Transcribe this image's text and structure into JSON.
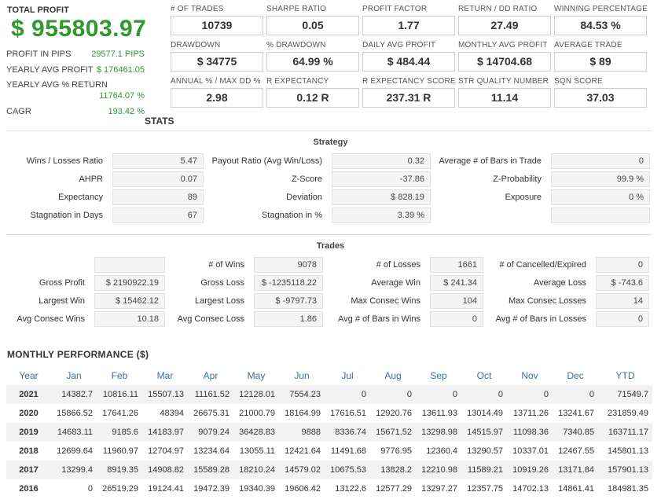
{
  "summary": {
    "total_profit_label": "TOTAL PROFIT",
    "total_profit_value": "$ 955803.97",
    "rows": [
      {
        "label": "PROFIT IN PIPS",
        "value": "29577.1 PIPS"
      },
      {
        "label": "YEARLY AVG PROFIT",
        "value": "$ 176461.05"
      },
      {
        "label": "YEARLY AVG % RETURN",
        "value": "11764.07 %"
      },
      {
        "label": "CAGR",
        "value": "193.42 %"
      }
    ]
  },
  "kpis": [
    {
      "label": "# OF TRADES",
      "value": "10739"
    },
    {
      "label": "SHARPE RATIO",
      "value": "0.05"
    },
    {
      "label": "PROFIT FACTOR",
      "value": "1.77"
    },
    {
      "label": "RETURN / DD RATIO",
      "value": "27.49"
    },
    {
      "label": "WINNING PERCENTAGE",
      "value": "84.53 %"
    },
    {
      "label": "DRAWDOWN",
      "value": "$ 34775"
    },
    {
      "label": "% DRAWDOWN",
      "value": "64.99 %"
    },
    {
      "label": "DAILY AVG PROFIT",
      "value": "$ 484.44"
    },
    {
      "label": "MONTHLY AVG PROFIT",
      "value": "$ 14704.68"
    },
    {
      "label": "AVERAGE TRADE",
      "value": "$ 89"
    },
    {
      "label": "ANNUAL % / MAX DD %",
      "value": "2.98"
    },
    {
      "label": "R EXPECTANCY",
      "value": "0.12 R"
    },
    {
      "label": "R EXPECTANCY SCORE",
      "value": "237.31 R"
    },
    {
      "label": "STR QUALITY NUMBER",
      "value": "11.14"
    },
    {
      "label": "SQN SCORE",
      "value": "37.03"
    }
  ],
  "stats_title": "STATS",
  "strategy": {
    "title": "Strategy",
    "rows": [
      [
        {
          "label": "Wins / Losses Ratio",
          "value": "5.47"
        },
        {
          "label": "Payout Ratio (Avg Win/Loss)",
          "value": "0.32"
        },
        {
          "label": "Average # of Bars in Trade",
          "value": "0"
        }
      ],
      [
        {
          "label": "AHPR",
          "value": "0.07"
        },
        {
          "label": "Z-Score",
          "value": "-37.86"
        },
        {
          "label": "Z-Probability",
          "value": "99.9 %"
        }
      ],
      [
        {
          "label": "Expectancy",
          "value": "89"
        },
        {
          "label": "Deviation",
          "value": "$ 828.19"
        },
        {
          "label": "Exposure",
          "value": "0 %"
        }
      ],
      [
        {
          "label": "Stagnation in Days",
          "value": "67"
        },
        {
          "label": "Stagnation in %",
          "value": "3.39 %"
        },
        {
          "label": "",
          "value": ""
        }
      ]
    ]
  },
  "trades": {
    "title": "Trades",
    "rows": [
      [
        {
          "label": "",
          "value": ""
        },
        {
          "label": "# of Wins",
          "value": "9078"
        },
        {
          "label": "# of Losses",
          "value": "1661"
        },
        {
          "label": "# of Cancelled/Expired",
          "value": "0"
        }
      ],
      [
        {
          "label": "Gross Profit",
          "value": "$ 2190922.19"
        },
        {
          "label": "Gross Loss",
          "value": "$ -1235118.22"
        },
        {
          "label": "Average Win",
          "value": "$ 241.34"
        },
        {
          "label": "Average Loss",
          "value": "$ -743.6"
        }
      ],
      [
        {
          "label": "Largest Win",
          "value": "$ 15462.12"
        },
        {
          "label": "Largest Loss",
          "value": "$ -9797.73"
        },
        {
          "label": "Max Consec Wins",
          "value": "104"
        },
        {
          "label": "Max Consec Losses",
          "value": "14"
        }
      ],
      [
        {
          "label": "Avg Consec Wins",
          "value": "10.18"
        },
        {
          "label": "Avg Consec Loss",
          "value": "1.86"
        },
        {
          "label": "Avg # of Bars in Wins",
          "value": "0"
        },
        {
          "label": "Avg # of Bars in Losses",
          "value": "0"
        }
      ]
    ]
  },
  "monthly": {
    "title": "MONTHLY PERFORMANCE ($)",
    "headers": [
      "Year",
      "Jan",
      "Feb",
      "Mar",
      "Apr",
      "May",
      "Jun",
      "Jul",
      "Aug",
      "Sep",
      "Oct",
      "Nov",
      "Dec",
      "YTD"
    ],
    "rows": [
      [
        "2021",
        "14382.7",
        "10816.11",
        "15507.13",
        "11161.52",
        "12128.01",
        "7554.23",
        "0",
        "0",
        "0",
        "0",
        "0",
        "0",
        "71549.7"
      ],
      [
        "2020",
        "15866.52",
        "17641.26",
        "48394",
        "26675.31",
        "21000.79",
        "18164.99",
        "17616.51",
        "12920.76",
        "13611.93",
        "13014.49",
        "13711.26",
        "13241.67",
        "231859.49"
      ],
      [
        "2019",
        "14683.11",
        "9185.6",
        "14183.97",
        "9079.24",
        "36428.83",
        "9888",
        "8336.74",
        "15671.52",
        "13298.98",
        "14515.97",
        "11098.36",
        "7340.85",
        "163711.17"
      ],
      [
        "2018",
        "12699.64",
        "11960.97",
        "12704.97",
        "13234.64",
        "13055.11",
        "12421.64",
        "11491.68",
        "9776.95",
        "12360.4",
        "13290.57",
        "10337.01",
        "12467.55",
        "145801.13"
      ],
      [
        "2017",
        "13299.4",
        "8919.35",
        "14908.82",
        "15589.28",
        "18210.24",
        "14579.02",
        "10675.53",
        "13828.2",
        "12210.98",
        "11589.21",
        "10919.26",
        "13171.84",
        "157901.13"
      ],
      [
        "2016",
        "0",
        "26519.29",
        "19124.41",
        "19472.39",
        "19340.39",
        "19606.42",
        "13122.6",
        "12577.29",
        "13297.27",
        "12357.75",
        "14702.13",
        "14861.41",
        "184981.35"
      ]
    ]
  },
  "colors": {
    "accent_green": "#2e9a2e",
    "header_blue": "#3a6ea8"
  }
}
